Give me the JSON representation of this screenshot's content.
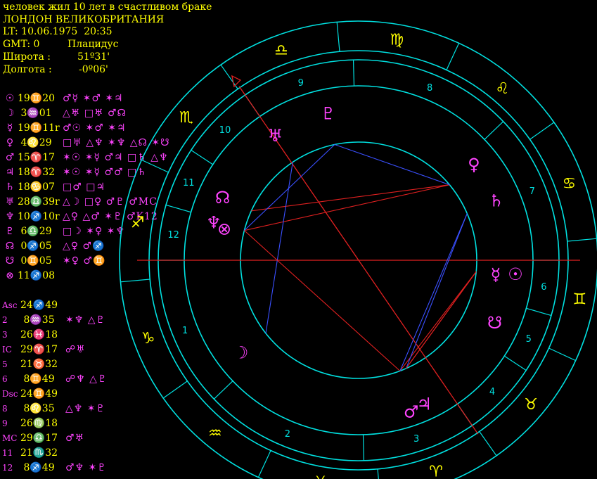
{
  "header": {
    "title": "человек жил 10 лет в счастливом браке",
    "place": "ЛОНДОН ВЕЛИКОБРИТАНИЯ",
    "lt": "LT: 10.06.1975  20:35",
    "gmt": "GMT: 0",
    "system": "Плацидус",
    "lat_label": "Широта :",
    "lat_value": "51º31'",
    "lon_label": "Долгота :",
    "lon_value": "-0º06'"
  },
  "planets": [
    {
      "glyph": "☉",
      "value": "19♊20",
      "aspects": "♂☿ ✶♂ ✶♃"
    },
    {
      "glyph": "☽",
      "value": " 3♒01",
      "aspects": "△♅ □♅ ♂☊"
    },
    {
      "glyph": "☿",
      "value": "19♊11r",
      "aspects": "♂☉ ✶♂ ✶♃"
    },
    {
      "glyph": "♀",
      "value": " 4♌29",
      "aspects": "□♅ △♆ ✶♆ △☊ ✶☋"
    },
    {
      "glyph": "♂",
      "value": "15♈17",
      "aspects": "✶☉ ✶☿ ♂♃ □♄ △♆"
    },
    {
      "glyph": "♃",
      "value": "18♈32",
      "aspects": "✶☉ ✶☿ ♂♂ □♄"
    },
    {
      "glyph": "♄",
      "value": "18♋07",
      "aspects": "□♂ □♃"
    },
    {
      "glyph": "♅",
      "value": "28♎39r",
      "aspects": "△☽ □♀ ♂♇ ♂MC"
    },
    {
      "glyph": "♆",
      "value": "10♐10r",
      "aspects": "△♀ △♂ ✶♇ ♂K12"
    },
    {
      "glyph": "♇",
      "value": " 6♎29",
      "aspects": "□☽ ✶♀ ✶♆"
    },
    {
      "glyph": "☊",
      "value": " 0♐05",
      "aspects": "△♀ ♂♐"
    },
    {
      "glyph": "☋",
      "value": " 0♊05",
      "aspects": "✶♀ ♂♊"
    },
    {
      "glyph": "⊗",
      "value": "11♐08",
      "aspects": ""
    }
  ],
  "houses": [
    {
      "label": "Asc",
      "value": "24♐49",
      "aspects": ""
    },
    {
      "label": "2",
      "value": " 8♒35",
      "aspects": "✶♆ △♇"
    },
    {
      "label": "3",
      "value": "26♓18",
      "aspects": ""
    },
    {
      "label": "IC",
      "value": "29♈17",
      "aspects": "☍♅"
    },
    {
      "label": "5",
      "value": "21♉32",
      "aspects": ""
    },
    {
      "label": "6",
      "value": " 8♊49",
      "aspects": "☍♆ △♇"
    },
    {
      "label": "Dsc",
      "value": "24♊49",
      "aspects": ""
    },
    {
      "label": "8",
      "value": " 8♌35",
      "aspects": "△♆ ✶♇"
    },
    {
      "label": "9",
      "value": "26♍18",
      "aspects": ""
    },
    {
      "label": "MC",
      "value": "29♎17",
      "aspects": "♂♅"
    },
    {
      "label": "11",
      "value": "21♏32",
      "aspects": ""
    },
    {
      "label": "12",
      "value": " 8♐49",
      "aspects": "♂♆ ✶♇"
    }
  ],
  "wheel": {
    "zodiac_signs": [
      "♐",
      "♑",
      "♒",
      "♓",
      "♈",
      "♉",
      "♊",
      "♋",
      "♌",
      "♍",
      "♎",
      "♏"
    ],
    "house_numbers": [
      "1",
      "2",
      "3",
      "4",
      "5",
      "6",
      "7",
      "8",
      "9",
      "10",
      "11",
      "12"
    ],
    "planet_glyphs": [
      {
        "name": "sun",
        "glyph": "☉",
        "color": "#ff44ff"
      },
      {
        "name": "moon",
        "glyph": "☽",
        "color": "#ff44ff"
      },
      {
        "name": "mercury",
        "glyph": "☿",
        "color": "#ff44ff"
      },
      {
        "name": "venus",
        "glyph": "♀",
        "color": "#ff44ff"
      },
      {
        "name": "mars",
        "glyph": "♂",
        "color": "#ff44ff"
      },
      {
        "name": "jupiter",
        "glyph": "♃",
        "color": "#ff44ff"
      },
      {
        "name": "saturn",
        "glyph": "♄",
        "color": "#ff44ff"
      },
      {
        "name": "uranus",
        "glyph": "♅",
        "color": "#ff44ff"
      },
      {
        "name": "neptune",
        "glyph": "♆",
        "color": "#ff44ff"
      },
      {
        "name": "pluto",
        "glyph": "♇",
        "color": "#ff44ff"
      },
      {
        "name": "north-node",
        "glyph": "☊",
        "color": "#ff44ff"
      },
      {
        "name": "south-node",
        "glyph": "☋",
        "color": "#ff44ff"
      },
      {
        "name": "fortune",
        "glyph": "⊗",
        "color": "#ff44ff"
      }
    ],
    "colors": {
      "ring": "#00e0e0",
      "sign": "#ffff00",
      "planet": "#ff44ff",
      "axis": "#e02020",
      "aspect_red": "#e02020",
      "aspect_blue": "#3a50ff"
    }
  }
}
